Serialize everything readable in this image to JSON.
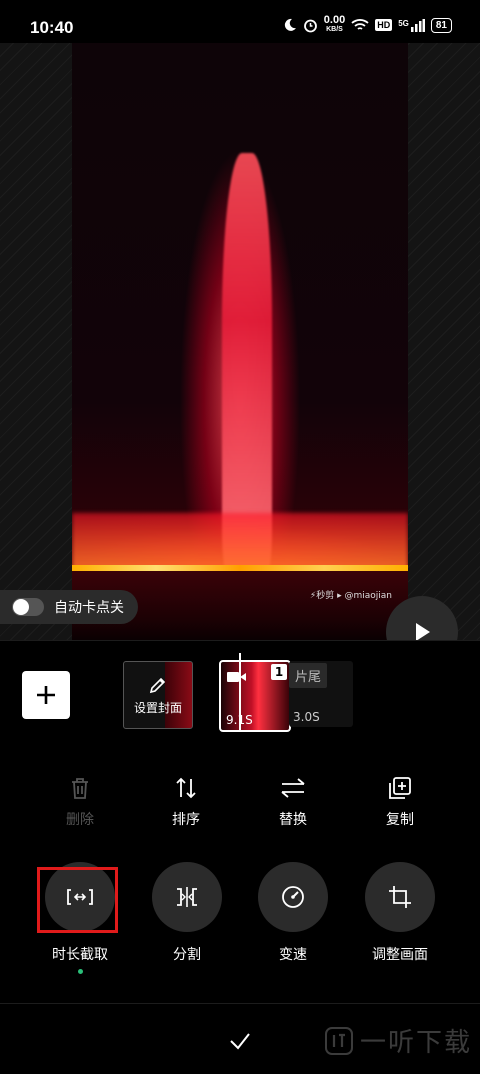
{
  "status_bar": {
    "time": "10:40",
    "net_speed": "0.00",
    "net_unit": "KB/S",
    "hd": "HD",
    "signal": "5G",
    "battery": "81"
  },
  "preview": {
    "watermark": "⚡秒剪 ▸ @miaojian",
    "auto_beat_label": "自动卡点关",
    "auto_beat_on": false
  },
  "timeline": {
    "cover_label": "设置封面",
    "clip": {
      "index": "1",
      "duration": "9.1S"
    },
    "end_clip": {
      "label": "片尾",
      "duration": "3.0S"
    }
  },
  "actions": [
    {
      "label": "删除",
      "icon": "trash-icon",
      "enabled": false
    },
    {
      "label": "排序",
      "icon": "sort-icon",
      "enabled": true
    },
    {
      "label": "替换",
      "icon": "replace-icon",
      "enabled": true
    },
    {
      "label": "复制",
      "icon": "copy-icon",
      "enabled": true
    }
  ],
  "tools": [
    {
      "label": "时长截取",
      "icon": "trim-icon",
      "active": true
    },
    {
      "label": "分割",
      "icon": "split-icon",
      "active": false
    },
    {
      "label": "变速",
      "icon": "speed-icon",
      "active": false
    },
    {
      "label": "调整画面",
      "icon": "crop-icon",
      "active": false
    }
  ],
  "brand_watermark": "一听下载",
  "colors": {
    "highlight": "#e01b1b",
    "active_dot": "#2bc07a",
    "tool_bg": "#2b2b2b"
  }
}
